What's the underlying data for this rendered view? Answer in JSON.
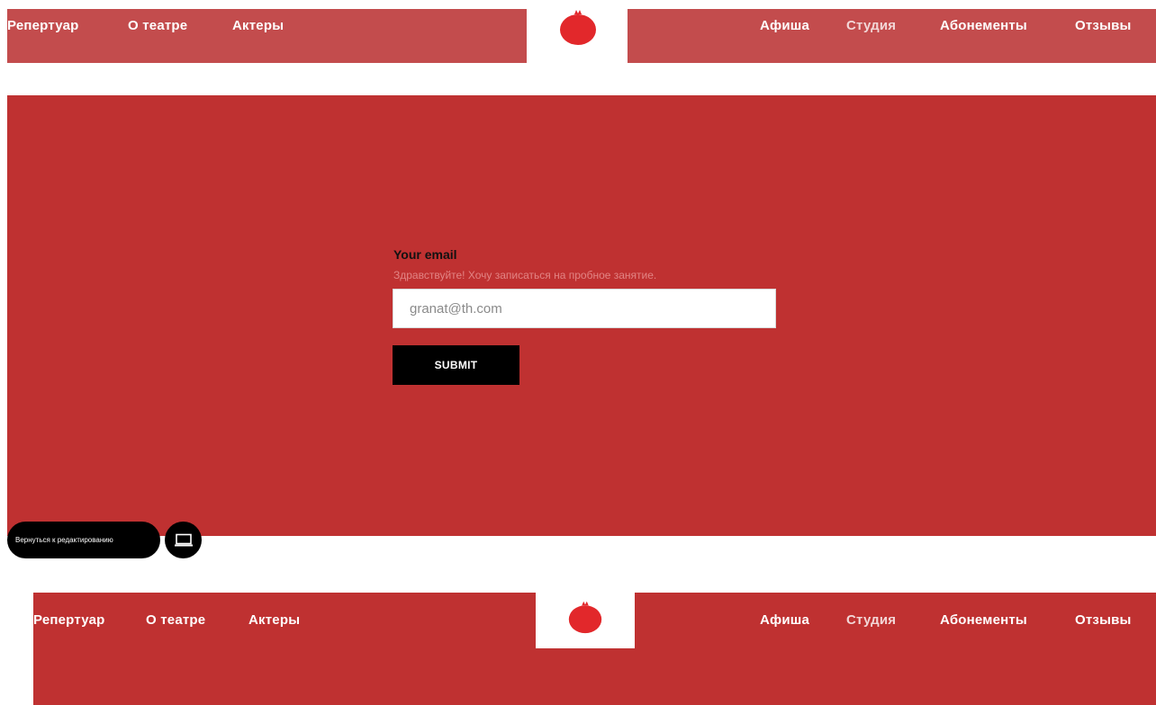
{
  "header": {
    "nav_left": [
      "Репертуар",
      "О театре",
      "Актеры"
    ],
    "nav_right": [
      "Афиша",
      "Студия",
      "Абонементы",
      "Отзывы"
    ],
    "logo_icon": "pomegranate-icon"
  },
  "form": {
    "label": "Your email",
    "hint": "Здравствуйте! Хочу записаться на пробное занятие.",
    "email_value": "granat@th.com",
    "submit_label": "SUBMIT"
  },
  "editor": {
    "back_label": "Вернуться к редактированию",
    "device_icon": "laptop-icon"
  },
  "bottom_header": {
    "nav_left": [
      "Репертуар",
      "О театре",
      "Актеры"
    ],
    "nav_right": [
      "Афиша",
      "Студия",
      "Абонементы",
      "Отзывы"
    ]
  },
  "colors": {
    "header_red": "#c34c4d",
    "section_red": "#bf3131",
    "button_black": "#000000"
  }
}
